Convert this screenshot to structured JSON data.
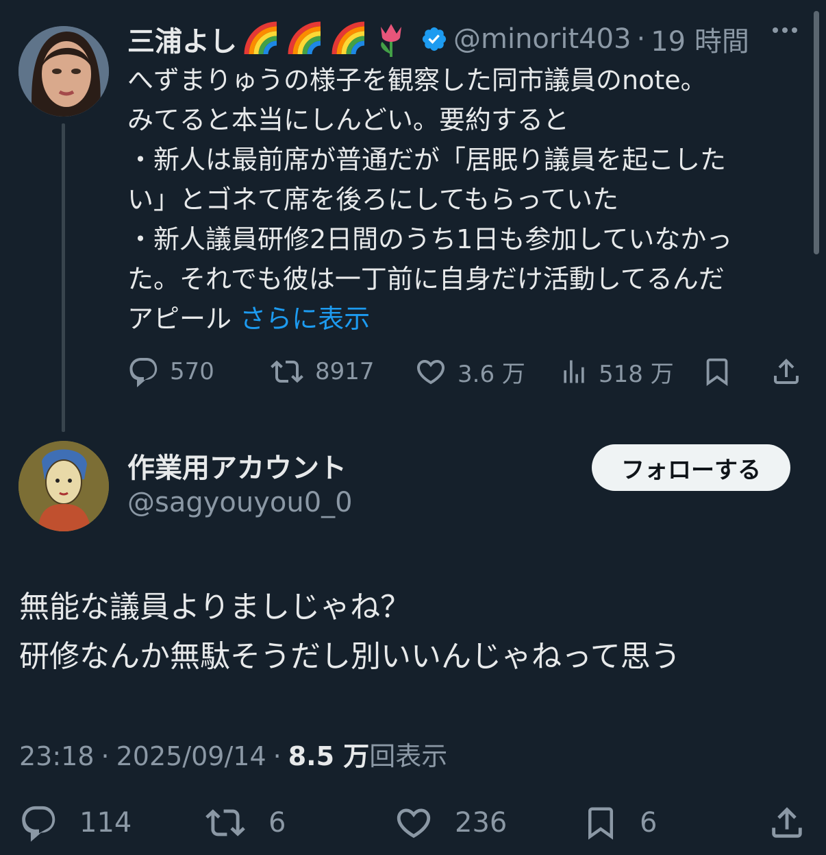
{
  "tweet1": {
    "display_name": "三浦よし",
    "emoji_icons": [
      "rainbow-emoji",
      "rainbow-emoji",
      "rainbow-emoji",
      "tulip-emoji"
    ],
    "handle": "@minorit403",
    "separator": "·",
    "time": "19 時間",
    "body": "へずまりゅうの様子を観察した同市議員のnote。\nみてると本当にしんどい。要約すると\n・新人は最前席が普通だが「居眠り議員を起こした\nい」とゴネて席を後ろにしてもらっていた\n・新人議員研修2日間のうち1日も参加していなかっ\nた。それでも彼は一丁前に自身だけ活動してるんだ\nアピール ",
    "show_more": "さらに表示",
    "replies": "570",
    "retweets": "8917",
    "likes": "3.6 万",
    "views": "518 万"
  },
  "tweet2": {
    "display_name": "作業用アカウント",
    "handle": "@sagyouyou0_0",
    "follow_label": "フォローする",
    "body": "無能な議員よりましじゃね？\n研修なんか無駄そうだし別いいんじゃねって思う",
    "time": "23:18",
    "separator": "·",
    "date": "2025/09/14",
    "views_count": "8.5 万",
    "views_label": "回表示",
    "replies": "114",
    "retweets": "6",
    "likes": "236",
    "bookmarks": "6"
  },
  "colors": {
    "background": "#15202b",
    "text": "#e7e9ea",
    "muted": "#8b98a5",
    "link": "#1d9bf0",
    "verified": "#1d9bf0"
  }
}
